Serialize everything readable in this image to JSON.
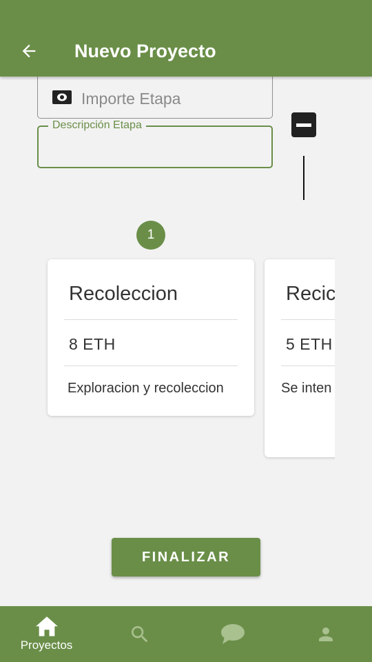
{
  "header": {
    "title": "Nuevo Proyecto",
    "back_icon": "arrow-left-icon"
  },
  "form": {
    "importe": {
      "placeholder": "Importe Etapa",
      "value": "",
      "icon": "money-icon"
    },
    "descripcion": {
      "label": "Descripción Etapa",
      "value": ""
    },
    "remove_icon": "minus-icon"
  },
  "stepper": {
    "current_step": "1"
  },
  "stages": [
    {
      "name": "Recoleccion",
      "amount": "8 ETH",
      "description": "Exploracion y recoleccion"
    },
    {
      "name": "Recic",
      "amount": "5 ETH",
      "description": "Se inten basura e lo posibl"
    }
  ],
  "actions": {
    "finalize_label": "FINALIZAR"
  },
  "bottom_nav": {
    "items": [
      {
        "label": "Proyectos",
        "icon": "home-icon",
        "active": true
      },
      {
        "label": "",
        "icon": "search-icon",
        "active": false
      },
      {
        "label": "",
        "icon": "chat-icon",
        "active": false
      },
      {
        "label": "",
        "icon": "profile-icon",
        "active": false
      }
    ]
  },
  "colors": {
    "primary": "#6a8e48",
    "inactive_icon": "#a9c08f",
    "background": "#f2f2f2"
  }
}
